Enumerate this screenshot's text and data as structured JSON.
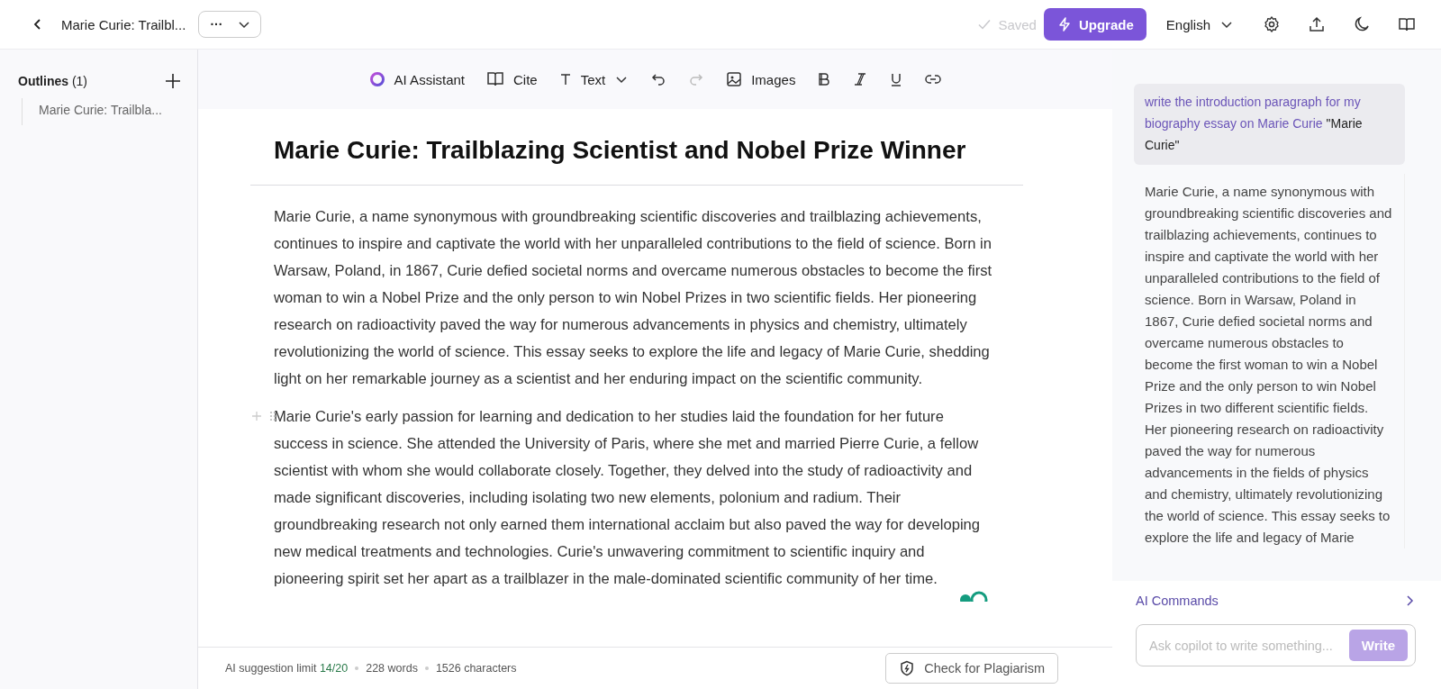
{
  "header": {
    "title": "Marie Curie: Trailbl...",
    "more_label": "···",
    "saved": {
      "label": "Saved",
      "disabled": true
    },
    "upgrade": "Upgrade",
    "language": "English"
  },
  "sidebar": {
    "title": "Outlines",
    "count": "(1)",
    "items": [
      {
        "label": "Marie Curie: Trailbla..."
      }
    ]
  },
  "toolbar": [
    {
      "kind": "ai",
      "label": "AI Assistant",
      "disabled": false
    },
    {
      "kind": "cite",
      "label": "Cite",
      "disabled": false
    },
    {
      "kind": "text",
      "label": "Text",
      "disabled": false
    },
    {
      "kind": "undo",
      "disabled": false
    },
    {
      "kind": "redo",
      "disabled": true
    },
    {
      "kind": "images",
      "label": "Images",
      "disabled": false
    },
    {
      "kind": "bold",
      "disabled": false
    },
    {
      "kind": "italic",
      "disabled": false
    },
    {
      "kind": "underline",
      "disabled": false
    },
    {
      "kind": "link",
      "disabled": false
    }
  ],
  "document": {
    "title": "Marie Curie: Trailblazing Scientist and Nobel Prize Winner",
    "paragraphs": [
      "Marie Curie, a name synonymous with groundbreaking scientific discoveries and trailblazing achievements, continues to inspire and captivate the world with her unparalleled contributions to the field of science. Born in Warsaw, Poland, in 1867, Curie defied societal norms and overcame numerous obstacles to become the first woman to win a Nobel Prize and the only person to win Nobel Prizes in two scientific fields. Her pioneering research on radioactivity paved the way for numerous advancements in physics and chemistry, ultimately revolutionizing the world of science. This essay seeks to explore the life and legacy of Marie Curie, shedding light on her remarkable journey as a scientist and her enduring impact on the scientific community.",
      "Marie Curie's early passion for learning and dedication to her studies laid the foundation for her future success in science. She attended the University of Paris, where she met and married Pierre Curie, a fellow scientist with whom she would collaborate closely. Together, they delved into the study of radioactivity and made significant discoveries, including isolating two new elements, polonium and radium. Their groundbreaking research not only earned them international acclaim but also paved the way for developing new medical treatments and technologies. Curie's unwavering commitment to scientific inquiry and pioneering spirit set her apart as a trailblazer in the male-dominated scientific community of her time."
    ]
  },
  "status_bar": {
    "limit_label": "AI suggestion limit",
    "limit_value": "14/20",
    "words": "228 words",
    "characters": "1526 characters",
    "plagiarism_button": "Check for Plagiarism"
  },
  "assistant": {
    "prompt": "write the introduction paragraph for my biography essay on Marie Curie",
    "prompt_quote": "\"Marie Curie\"",
    "response": "Marie Curie, a name synonymous with groundbreaking scientific discoveries and trailblazing achievements, continues to inspire and captivate the world with her unparalleled contributions to the field of science. Born in Warsaw, Poland in 1867, Curie defied societal norms and overcame numerous obstacles to become the first woman to win a Nobel Prize and the only person to win Nobel Prizes in two different scientific fields. Her pioneering research on radioactivity paved the way for numerous advancements in the fields of physics and chemistry, ultimately revolutionizing the world of science. This essay seeks to explore the life and legacy of Marie",
    "commands_label": "AI Commands",
    "input_placeholder": "Ask copilot to write something...",
    "write_button": "Write"
  }
}
